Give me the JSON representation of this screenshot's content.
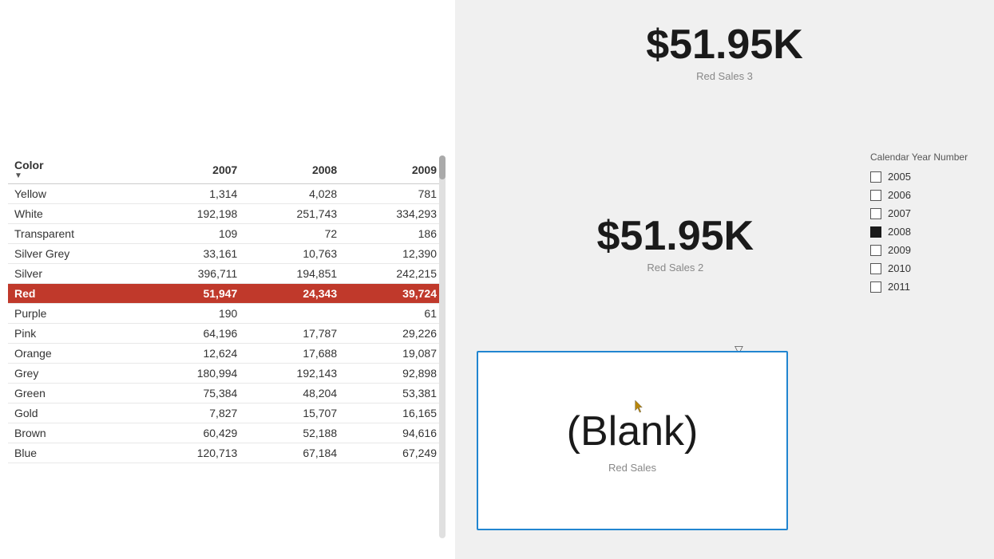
{
  "table": {
    "title": "Color 2007",
    "headers": [
      "Color",
      "2007",
      "2008",
      "2009"
    ],
    "rows": [
      {
        "color": "Yellow",
        "v2007": "1,314",
        "v2008": "4,028",
        "v2009": "781",
        "highlight": false
      },
      {
        "color": "White",
        "v2007": "192,198",
        "v2008": "251,743",
        "v2009": "334,293",
        "highlight": false
      },
      {
        "color": "Transparent",
        "v2007": "109",
        "v2008": "72",
        "v2009": "186",
        "highlight": false
      },
      {
        "color": "Silver Grey",
        "v2007": "33,161",
        "v2008": "10,763",
        "v2009": "12,390",
        "highlight": false
      },
      {
        "color": "Silver",
        "v2007": "396,711",
        "v2008": "194,851",
        "v2009": "242,215",
        "highlight": false
      },
      {
        "color": "Red",
        "v2007": "51,947",
        "v2008": "24,343",
        "v2009": "39,724",
        "highlight": true
      },
      {
        "color": "Purple",
        "v2007": "190",
        "v2008": "",
        "v2009": "61",
        "highlight": false
      },
      {
        "color": "Pink",
        "v2007": "64,196",
        "v2008": "17,787",
        "v2009": "29,226",
        "highlight": false
      },
      {
        "color": "Orange",
        "v2007": "12,624",
        "v2008": "17,688",
        "v2009": "19,087",
        "highlight": false
      },
      {
        "color": "Grey",
        "v2007": "180,994",
        "v2008": "192,143",
        "v2009": "92,898",
        "highlight": false
      },
      {
        "color": "Green",
        "v2007": "75,384",
        "v2008": "48,204",
        "v2009": "53,381",
        "highlight": false
      },
      {
        "color": "Gold",
        "v2007": "7,827",
        "v2008": "15,707",
        "v2009": "16,165",
        "highlight": false
      },
      {
        "color": "Brown",
        "v2007": "60,429",
        "v2008": "52,188",
        "v2009": "94,616",
        "highlight": false
      },
      {
        "color": "Blue",
        "v2007": "120,713",
        "v2008": "67,184",
        "v2009": "67,249",
        "highlight": false
      }
    ]
  },
  "kpi": {
    "top_value": "$51.95K",
    "top_label": "Red Sales 3",
    "middle_value": "$51.95K",
    "middle_label": "Red Sales 2",
    "blank_value": "(Blank)",
    "blank_label": "Red Sales"
  },
  "legend": {
    "title": "Calendar Year Number",
    "items": [
      {
        "year": "2005",
        "checked": false
      },
      {
        "year": "2006",
        "checked": false
      },
      {
        "year": "2007",
        "checked": false
      },
      {
        "year": "2008",
        "checked": true
      },
      {
        "year": "2009",
        "checked": false
      },
      {
        "year": "2010",
        "checked": false
      },
      {
        "year": "2011",
        "checked": false
      }
    ]
  },
  "controls": {
    "filter_icon": "▽",
    "more_icon": "..."
  }
}
